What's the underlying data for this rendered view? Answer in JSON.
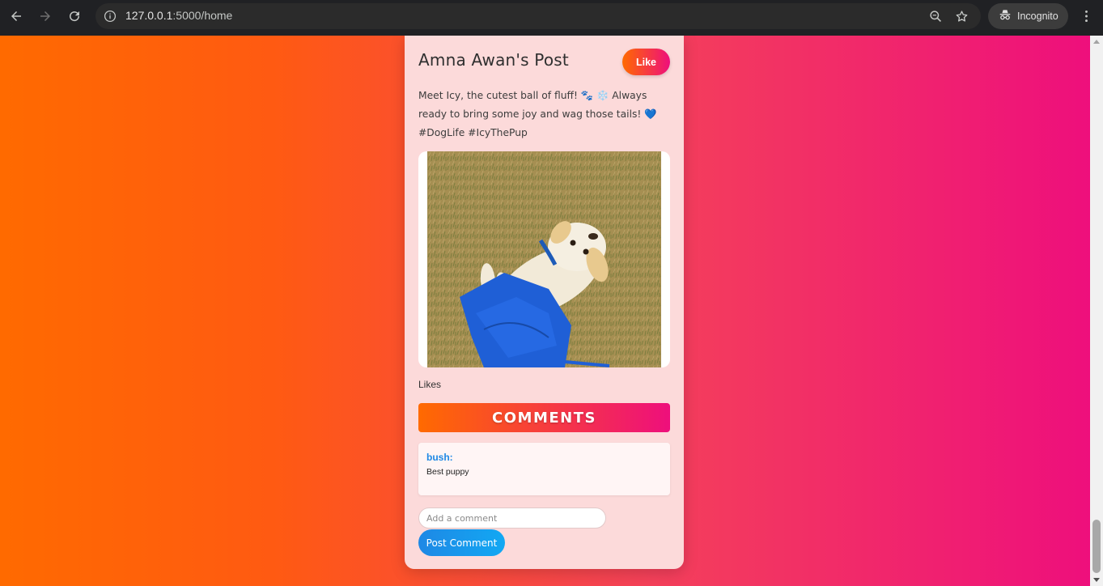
{
  "browser": {
    "url_host": "127.0.0.1",
    "url_path": ":5000/home",
    "incognito_label": "Incognito",
    "icons": [
      "back-arrow-icon",
      "forward-arrow-icon",
      "reload-icon",
      "site-info-icon",
      "zoom-icon",
      "bookmark-star-icon",
      "incognito-icon",
      "more-menu-icon"
    ]
  },
  "post": {
    "title": "Amna Awan's Post",
    "like_label": "Like",
    "caption": "Meet Icy, the cutest ball of fluff! 🐾 ❄️ Always ready to bring some joy and wag those tails! 💙 #DogLife #IcyThePup",
    "likes_label": "Likes"
  },
  "comments": {
    "header": "COMMENTS",
    "items": [
      {
        "user": "bush:",
        "text": "Best puppy"
      }
    ],
    "input_placeholder": "Add a comment",
    "submit_label": "Post Comment"
  },
  "colors": {
    "gradient_start": "#ff6a00",
    "gradient_end": "#ee0f7c",
    "card_bg": "#fcdada",
    "comment_user": "#1e88e5",
    "button_blue": "#1e88e5"
  }
}
